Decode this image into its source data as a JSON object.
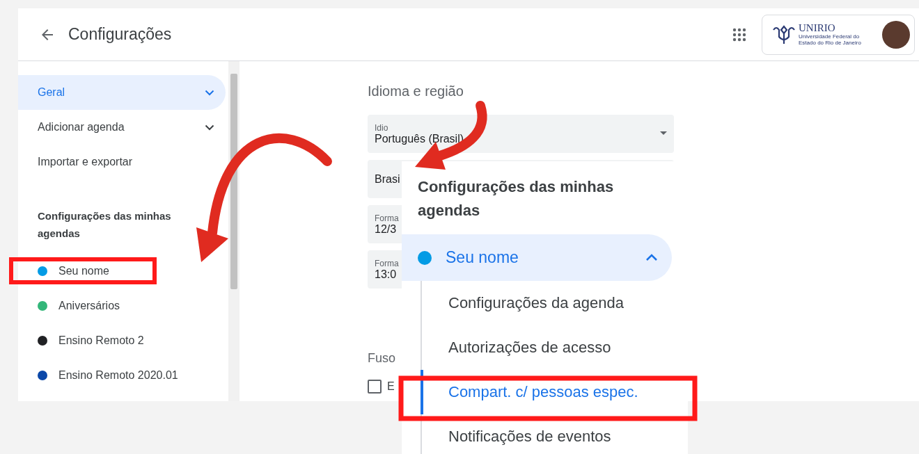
{
  "header": {
    "title": "Configurações"
  },
  "account": {
    "logo_name": "UNIRIO",
    "logo_subtitle": "Universidade Federal do Estado do Rio de Janeiro"
  },
  "sidebar": {
    "items": [
      {
        "label": "Geral",
        "kind": "expandable",
        "selected": true
      },
      {
        "label": "Adicionar agenda",
        "kind": "expandable",
        "selected": false
      },
      {
        "label": "Importar e exportar",
        "kind": "link",
        "selected": false
      }
    ],
    "section_title": "Configurações das minhas agendas",
    "calendars": [
      {
        "name": "Seu nome",
        "color": "#039be5"
      },
      {
        "name": "Aniversários",
        "color": "#33b679"
      },
      {
        "name": "Ensino Remoto 2",
        "color": "#202124"
      },
      {
        "name": "Ensino Remoto 2020.01",
        "color": "#0b47a8"
      }
    ]
  },
  "content": {
    "section_title": "Idioma e região",
    "fields": [
      {
        "label": "Idio",
        "value": "Português (Brasil)",
        "kind": "dropdown"
      },
      {
        "value": "Brasi",
        "kind": "plain"
      },
      {
        "label": "Forma",
        "value": "12/3",
        "kind": "plain"
      },
      {
        "label": "Forma",
        "value": "13:0",
        "kind": "plain"
      }
    ],
    "timezone_title": "Fuso",
    "checkbox": {
      "label": "E",
      "checked": false
    }
  },
  "inset": {
    "title": "Configurações das minhas agendas",
    "calendar": {
      "name": "Seu nome",
      "color": "#039be5",
      "expanded": true
    },
    "items": [
      {
        "label": "Configurações da agenda",
        "selected": false
      },
      {
        "label": "Autorizações de acesso",
        "selected": false
      },
      {
        "label": "Compart. c/ pessoas espec.",
        "selected": true
      },
      {
        "label": "Notificações de eventos",
        "selected": false
      }
    ]
  }
}
